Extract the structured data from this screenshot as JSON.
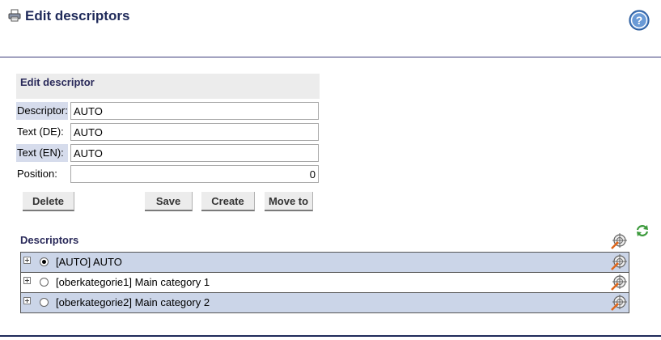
{
  "header": {
    "title": "Edit descriptors",
    "print_icon": "printer-icon",
    "help_icon": "help-icon"
  },
  "edit_panel": {
    "title": "Edit descriptor",
    "fields": {
      "descriptor": {
        "label": "Descriptor:",
        "value": "AUTO"
      },
      "text_de": {
        "label": "Text (DE):",
        "value": "AUTO"
      },
      "text_en": {
        "label": "Text (EN):",
        "value": "AUTO"
      },
      "position": {
        "label": "Position:",
        "value": "0"
      }
    },
    "buttons": {
      "delete": "Delete",
      "save": "Save",
      "create": "Create",
      "move_to": "Move to"
    }
  },
  "descriptors": {
    "title": "Descriptors",
    "refresh_icon": "refresh-icon",
    "target_icon": "target-icon",
    "rows": [
      {
        "label": "[AUTO] AUTO",
        "selected": true
      },
      {
        "label": "[oberkategorie1] Main category 1",
        "selected": false
      },
      {
        "label": "[oberkategorie2] Main category 2",
        "selected": false
      }
    ]
  },
  "colors": {
    "title": "#1f2a5a",
    "row_highlight": "#cbd5e8",
    "label_highlight": "#d6dcec",
    "panel_bg": "#ececec"
  }
}
